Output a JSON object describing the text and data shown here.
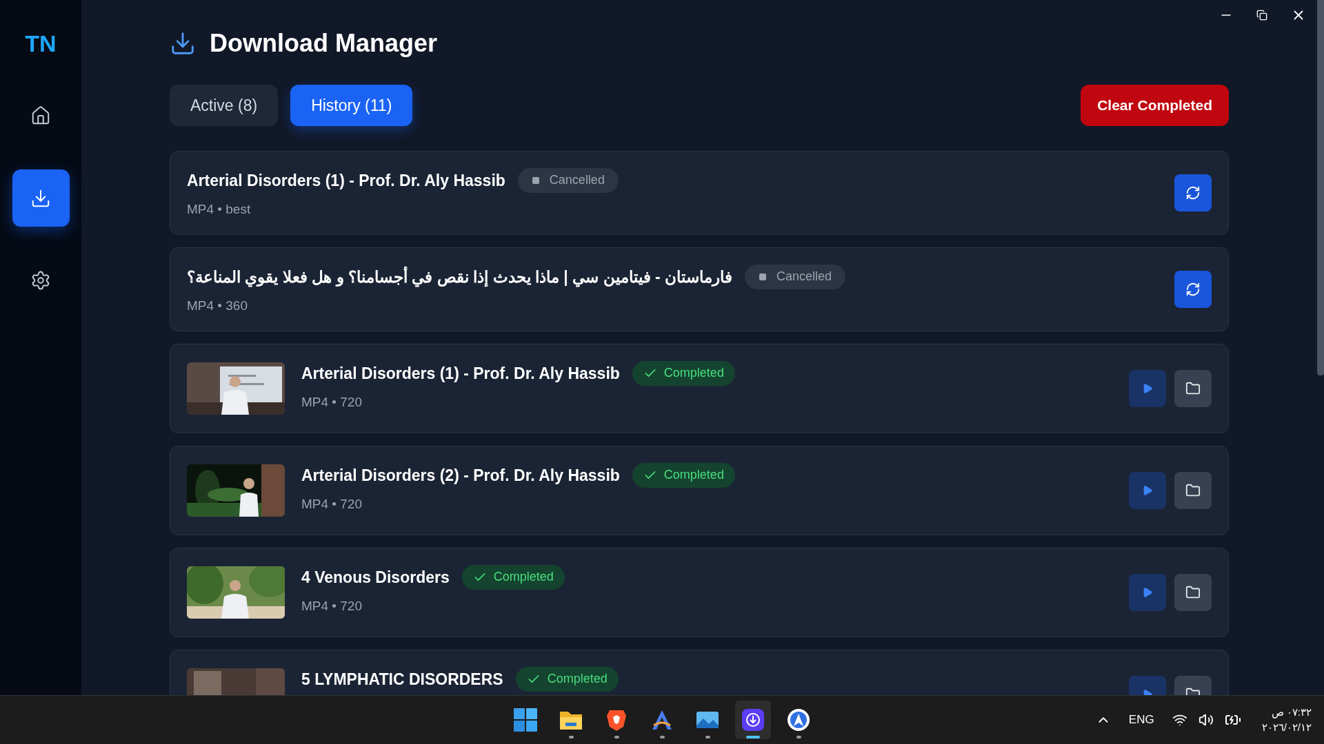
{
  "sidebar": {
    "logo": "TN",
    "items": [
      {
        "kind": "home",
        "selected": false
      },
      {
        "kind": "download",
        "selected": true
      },
      {
        "kind": "settings",
        "selected": false
      }
    ]
  },
  "header": {
    "title": "Download Manager"
  },
  "tabs": [
    {
      "label": "Active (8)",
      "selected": false
    },
    {
      "label": "History (11)",
      "selected": true
    }
  ],
  "clear_button": "Clear Completed",
  "downloads": [
    {
      "title": "Arterial Disorders (1) - Prof. Dr. Aly Hassib",
      "meta": "MP4 • best",
      "status": {
        "kind": "cancelled",
        "label": "Cancelled"
      }
    },
    {
      "title": "فارماستان - فيتامين سي | ماذا يحدث إذا نقص في أجسامنا؟ و هل فعلا يقوي المناعة؟",
      "meta": "MP4 • 360",
      "status": {
        "kind": "cancelled",
        "label": "Cancelled"
      }
    },
    {
      "title": "Arterial Disorders (1) - Prof. Dr. Aly Hassib",
      "meta": "MP4 • 720",
      "status": {
        "kind": "completed",
        "label": "Completed"
      }
    },
    {
      "title": "Arterial Disorders (2) - Prof. Dr. Aly Hassib",
      "meta": "MP4 • 720",
      "status": {
        "kind": "completed",
        "label": "Completed"
      }
    },
    {
      "title": "4 Venous Disorders",
      "meta": "MP4 • 720",
      "status": {
        "kind": "completed",
        "label": "Completed"
      }
    },
    {
      "title": "5 LYMPHATIC DISORDERS",
      "status": {
        "kind": "completed",
        "label": "Completed"
      }
    }
  ],
  "taskbar": {
    "apps": [
      {
        "kind": "start",
        "running": false,
        "selected": false
      },
      {
        "kind": "files",
        "running": true,
        "selected": false
      },
      {
        "kind": "browser",
        "running": true,
        "selected": false
      },
      {
        "kind": "editor",
        "running": true,
        "selected": false
      },
      {
        "kind": "photos",
        "running": true,
        "selected": false
      },
      {
        "kind": "downloader",
        "running": true,
        "selected": true
      },
      {
        "kind": "compass",
        "running": true,
        "selected": false
      }
    ],
    "language": "ENG",
    "time": "٠٧:٣٢ ص",
    "date": "٢٠٢٦/٠٢/١٢"
  }
}
